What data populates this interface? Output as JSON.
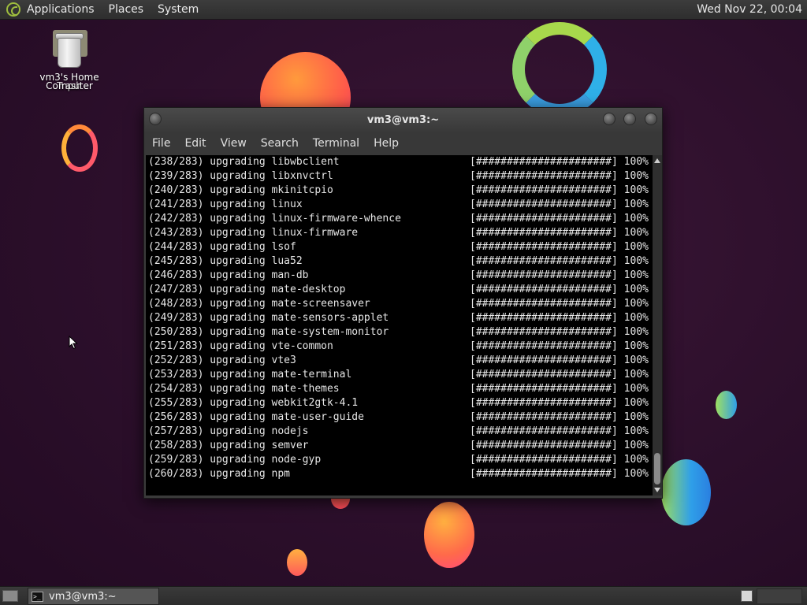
{
  "top_panel": {
    "menus": [
      "Applications",
      "Places",
      "System"
    ],
    "clock": "Wed Nov 22, 00:04"
  },
  "desktop_icons": {
    "computer_label_line1": "vm3's Home",
    "computer_label_line2": "Computer",
    "trash_label_line1": "Trash",
    "trash_label_line2": ""
  },
  "terminal": {
    "title": "vm3@vm3:~",
    "menu": [
      "File",
      "Edit",
      "View",
      "Search",
      "Terminal",
      "Help"
    ],
    "lines": [
      {
        "left": "(238/283) upgrading libwbclient",
        "right": "[######################] 100%"
      },
      {
        "left": "(239/283) upgrading libxnvctrl",
        "right": "[######################] 100%"
      },
      {
        "left": "(240/283) upgrading mkinitcpio",
        "right": "[######################] 100%"
      },
      {
        "left": "(241/283) upgrading linux",
        "right": "[######################] 100%"
      },
      {
        "left": "(242/283) upgrading linux-firmware-whence",
        "right": "[######################] 100%"
      },
      {
        "left": "(243/283) upgrading linux-firmware",
        "right": "[######################] 100%"
      },
      {
        "left": "(244/283) upgrading lsof",
        "right": "[######################] 100%"
      },
      {
        "left": "(245/283) upgrading lua52",
        "right": "[######################] 100%"
      },
      {
        "left": "(246/283) upgrading man-db",
        "right": "[######################] 100%"
      },
      {
        "left": "(247/283) upgrading mate-desktop",
        "right": "[######################] 100%"
      },
      {
        "left": "(248/283) upgrading mate-screensaver",
        "right": "[######################] 100%"
      },
      {
        "left": "(249/283) upgrading mate-sensors-applet",
        "right": "[######################] 100%"
      },
      {
        "left": "(250/283) upgrading mate-system-monitor",
        "right": "[######################] 100%"
      },
      {
        "left": "(251/283) upgrading vte-common",
        "right": "[######################] 100%"
      },
      {
        "left": "(252/283) upgrading vte3",
        "right": "[######################] 100%"
      },
      {
        "left": "(253/283) upgrading mate-terminal",
        "right": "[######################] 100%"
      },
      {
        "left": "(254/283) upgrading mate-themes",
        "right": "[######################] 100%"
      },
      {
        "left": "(255/283) upgrading webkit2gtk-4.1",
        "right": "[######################] 100%"
      },
      {
        "left": "(256/283) upgrading mate-user-guide",
        "right": "[######################] 100%"
      },
      {
        "left": "(257/283) upgrading nodejs",
        "right": "[######################] 100%"
      },
      {
        "left": "(258/283) upgrading semver",
        "right": "[######################] 100%"
      },
      {
        "left": "(259/283) upgrading node-gyp",
        "right": "[######################] 100%"
      },
      {
        "left": "(260/283) upgrading npm",
        "right": "[######################] 100%"
      }
    ]
  },
  "taskbar": {
    "window_button_label": "vm3@vm3:~",
    "task_icon_glyph": ">_"
  },
  "colors": {
    "desktop_bg": "#2c0f2b",
    "panel_bg": "#333333",
    "terminal_bg": "#000000",
    "terminal_fg": "#e6e6e6"
  }
}
